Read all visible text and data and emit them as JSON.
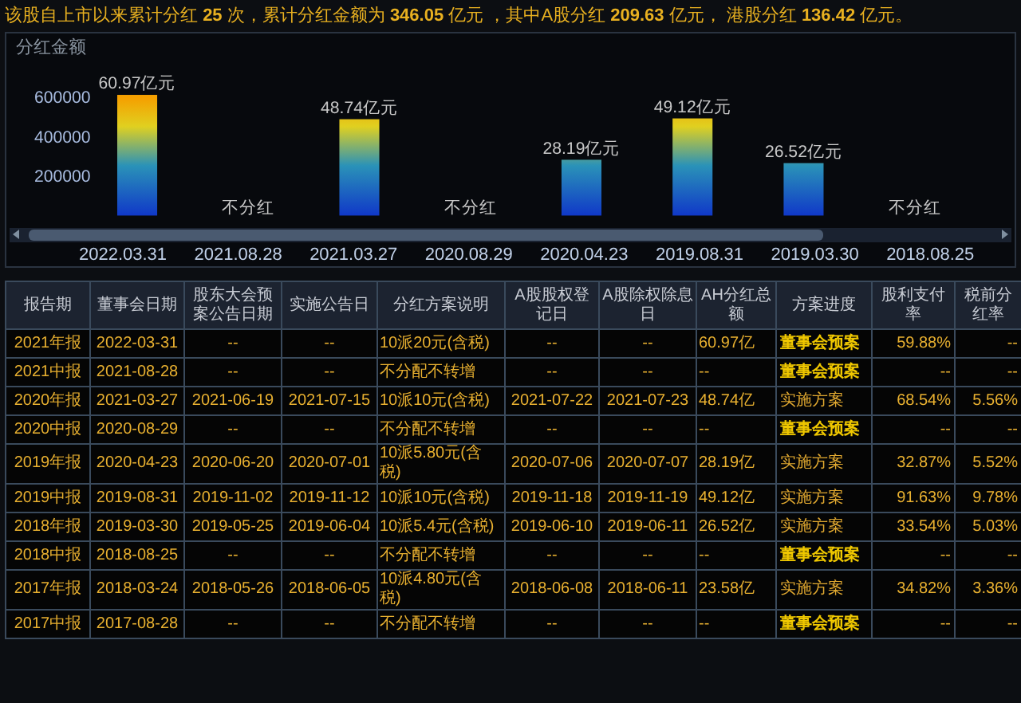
{
  "summary": "该股自上市以来累计分红 **25** 次，累计分红金额为 **346.05** 亿元 ，其中A股分红 **209.63** 亿元， 港股分红 **136.42** 亿元。",
  "chart": {
    "chart_data": {
      "type": "bar",
      "title": "分红金额",
      "categories": [
        "2022.03.31",
        "2021.08.28",
        "2021.03.27",
        "2020.08.29",
        "2020.04.23",
        "2019.08.31",
        "2019.03.30",
        "2018.08.25"
      ],
      "values": [
        610000,
        null,
        487000,
        null,
        282000,
        491000,
        265000,
        null
      ],
      "ylim": [
        0,
        900000
      ],
      "yticks": [
        200000,
        400000,
        600000
      ]
    },
    "bar_labels": [
      "60.97亿元",
      "不分红",
      "48.74亿元",
      "不分红",
      "28.19亿元",
      "49.12亿元",
      "26.52亿元",
      "不分红"
    ]
  },
  "table": {
    "columns": [
      "报告期",
      "董事会日期",
      "股东大会预案公告日期",
      "实施公告日",
      "分红方案说明",
      "A股股权登记日",
      "A股除权除息日",
      "AH分红总额",
      "方案进度",
      "股利支付率",
      "税前分红率"
    ],
    "rows": [
      {
        "cells": [
          "2021年报",
          "2022-03-31",
          "--",
          "--",
          "10派20元(含税)",
          "--",
          "--",
          "60.97亿"
        ],
        "status": {
          "text": "董事会预案",
          "kind": "board"
        },
        "payout": "59.88%",
        "yield": "--"
      },
      {
        "cells": [
          "2021中报",
          "2021-08-28",
          "--",
          "--",
          "不分配不转增",
          "--",
          "--",
          "--"
        ],
        "status": {
          "text": "董事会预案",
          "kind": "board"
        },
        "payout": "--",
        "yield": "--"
      },
      {
        "cells": [
          "2020年报",
          "2021-03-27",
          "2021-06-19",
          "2021-07-15",
          "10派10元(含税)",
          "2021-07-22",
          "2021-07-23",
          "48.74亿"
        ],
        "status": {
          "text": "实施方案",
          "kind": "implemented"
        },
        "payout": "68.54%",
        "yield": "5.56%"
      },
      {
        "cells": [
          "2020中报",
          "2020-08-29",
          "--",
          "--",
          "不分配不转增",
          "--",
          "--",
          "--"
        ],
        "status": {
          "text": "董事会预案",
          "kind": "board"
        },
        "payout": "--",
        "yield": "--"
      },
      {
        "cells": [
          "2019年报",
          "2020-04-23",
          "2020-06-20",
          "2020-07-01",
          "10派5.80元(含税)",
          "2020-07-06",
          "2020-07-07",
          "28.19亿"
        ],
        "status": {
          "text": "实施方案",
          "kind": "implemented"
        },
        "payout": "32.87%",
        "yield": "5.52%"
      },
      {
        "cells": [
          "2019中报",
          "2019-08-31",
          "2019-11-02",
          "2019-11-12",
          "10派10元(含税)",
          "2019-11-18",
          "2019-11-19",
          "49.12亿"
        ],
        "status": {
          "text": "实施方案",
          "kind": "implemented"
        },
        "payout": "91.63%",
        "yield": "9.78%"
      },
      {
        "cells": [
          "2018年报",
          "2019-03-30",
          "2019-05-25",
          "2019-06-04",
          "10派5.4元(含税)",
          "2019-06-10",
          "2019-06-11",
          "26.52亿"
        ],
        "status": {
          "text": "实施方案",
          "kind": "implemented"
        },
        "payout": "33.54%",
        "yield": "5.03%"
      },
      {
        "cells": [
          "2018中报",
          "2018-08-25",
          "--",
          "--",
          "不分配不转增",
          "--",
          "--",
          "--"
        ],
        "status": {
          "text": "董事会预案",
          "kind": "board"
        },
        "payout": "--",
        "yield": "--"
      },
      {
        "cells": [
          "2017年报",
          "2018-03-24",
          "2018-05-26",
          "2018-06-05",
          "10派4.80元(含税)",
          "2018-06-08",
          "2018-06-11",
          "23.58亿"
        ],
        "status": {
          "text": "实施方案",
          "kind": "implemented"
        },
        "payout": "34.82%",
        "yield": "3.36%"
      },
      {
        "cells": [
          "2017中报",
          "2017-08-28",
          "--",
          "--",
          "不分配不转增",
          "--",
          "--",
          "--"
        ],
        "status": {
          "text": "董事会预案",
          "kind": "board"
        },
        "payout": "--",
        "yield": "--"
      }
    ]
  }
}
